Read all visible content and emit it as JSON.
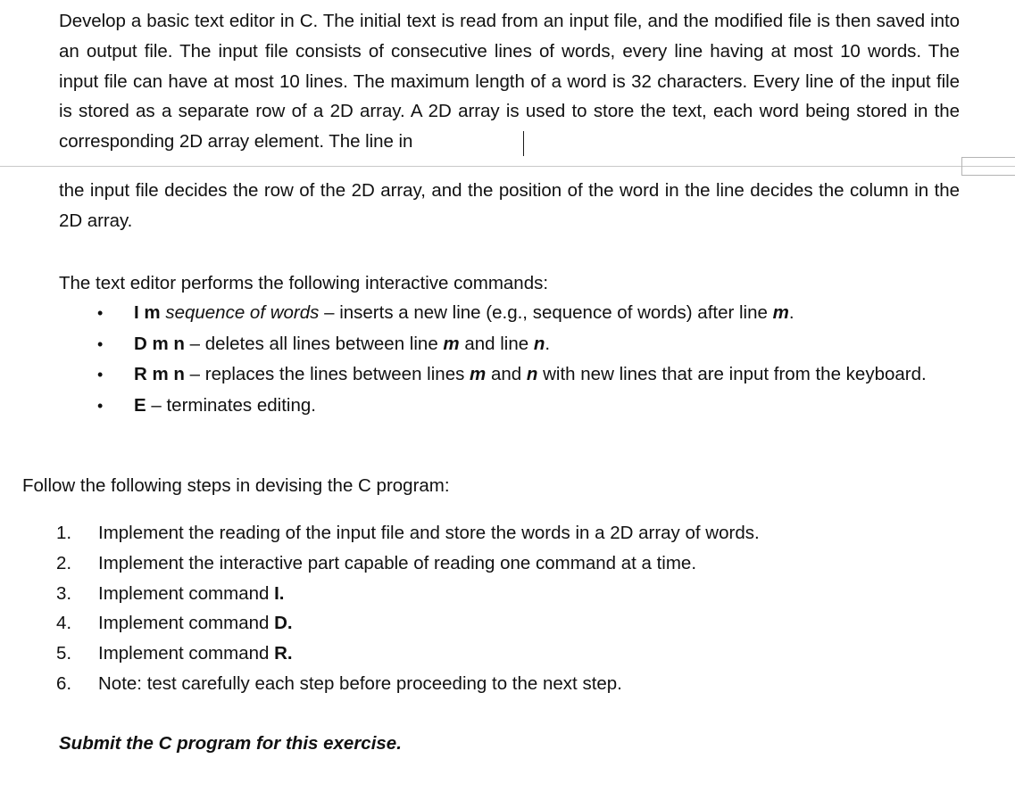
{
  "document": {
    "paragraph_intro_part1": "Develop a basic text editor in C. The initial text is read from an input file, and the modified file is then saved into an output file. The input file consists of consecutive lines of words, every line having at most 10 words. The input file can have at most 10 lines. The maximum length of a word is 32 characters. Every line of the input file is stored as a separate row of a 2D array. A 2D array is used to store the text, each word being stored in the corresponding 2D array element. The line in",
    "paragraph_intro_part2": "the input file decides the row of the 2D array, and the position of the word in the line decides the column in the 2D array.",
    "commands_intro": "The text editor performs the following interactive commands:",
    "follow_steps_intro": "Follow the following steps in devising the C program:",
    "submit_note": "Submit the C program for this exercise."
  },
  "commands": {
    "bullet_glyph": "•",
    "items": [
      {
        "command": "I m",
        "argument": " sequence of words",
        "description_before": " – inserts a new line (e.g., sequence of words) after line ",
        "variable": "m",
        "description_after": "."
      },
      {
        "command": "D m n",
        "argument": "",
        "description_before": " – deletes all lines between line ",
        "variable": "m",
        "description_mid": " and line ",
        "variable2": "n",
        "description_after": "."
      },
      {
        "command": "R m n",
        "argument": "",
        "description_before": " – replaces the lines between lines ",
        "variable": "m",
        "description_mid": " and ",
        "variable2": "n",
        "description_after": " with new lines that are input from the keyboard."
      },
      {
        "command": "E",
        "argument": "",
        "description_before": " – terminates editing.",
        "variable": "",
        "description_after": ""
      }
    ]
  },
  "steps": {
    "items": [
      {
        "number": "1.",
        "text": "Implement the reading of the input file and store the words in a 2D array of words.",
        "command": ""
      },
      {
        "number": "2.",
        "text": "Implement the interactive part capable of reading one command at a time.",
        "command": ""
      },
      {
        "number": "3.",
        "text": "Implement command ",
        "command": "I."
      },
      {
        "number": "4.",
        "text": "Implement command ",
        "command": "D."
      },
      {
        "number": "5.",
        "text": "Implement command ",
        "command": "R."
      },
      {
        "number": "6.",
        "text": "Note: test carefully each step before proceeding to the next step.",
        "command": ""
      }
    ]
  },
  "page_break": {
    "present": true,
    "rule_color": "#c9c9c9",
    "marker_color": "#b4b4b4"
  },
  "caret": {
    "present": true,
    "color": "#1a1a1a"
  },
  "theme": {
    "background": "#ffffff",
    "text_color": "#111111"
  }
}
